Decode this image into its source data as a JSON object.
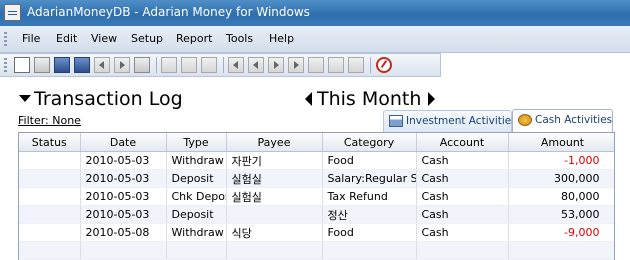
{
  "window": {
    "title": "AdarianMoneyDB - Adarian Money for Windows"
  },
  "menu": [
    "File",
    "Edit",
    "View",
    "Setup",
    "Report",
    "Tools",
    "Help"
  ],
  "toolbar": {
    "buttons": [
      "new-icon",
      "open-icon",
      "save-icon",
      "print-icon",
      "back-icon",
      "forward-icon",
      "export-icon",
      "add-icon",
      "edit-icon",
      "view-icon",
      "first-icon",
      "prev-icon",
      "next-icon",
      "last-icon",
      "new-record-icon",
      "copy-record-icon",
      "delete-record-icon",
      "exit-icon"
    ]
  },
  "view": {
    "title": "Transaction Log",
    "period": "This Month",
    "filter": "Filter: None"
  },
  "tabs": [
    {
      "label": "Investment Activities",
      "active": false
    },
    {
      "label": "Cash Activities",
      "active": true
    }
  ],
  "table": {
    "columns": [
      "Status",
      "Date",
      "Type",
      "Payee",
      "Category",
      "Account",
      "Amount"
    ],
    "rows": [
      {
        "status": "",
        "date": "2010-05-03",
        "type": "Withdraw",
        "payee": "자판기",
        "category": "Food",
        "account": "Cash",
        "amount": "-1,000"
      },
      {
        "status": "",
        "date": "2010-05-03",
        "type": "Deposit",
        "payee": "실험실",
        "category": "Salary:Regular Salary",
        "account": "Cash",
        "amount": "300,000"
      },
      {
        "status": "",
        "date": "2010-05-03",
        "type": "Chk Deposit",
        "payee": "실험실",
        "category": "Tax Refund",
        "account": "Cash",
        "amount": "80,000"
      },
      {
        "status": "",
        "date": "2010-05-03",
        "type": "Deposit",
        "payee": "",
        "category": "정산",
        "account": "Cash",
        "amount": "53,000"
      },
      {
        "status": "",
        "date": "2010-05-08",
        "type": "Withdraw",
        "payee": "식당",
        "category": "Food",
        "account": "Cash",
        "amount": "-9,000"
      }
    ]
  },
  "colors": {
    "negative": "#e00000",
    "titlebar": "#2f6fae"
  }
}
